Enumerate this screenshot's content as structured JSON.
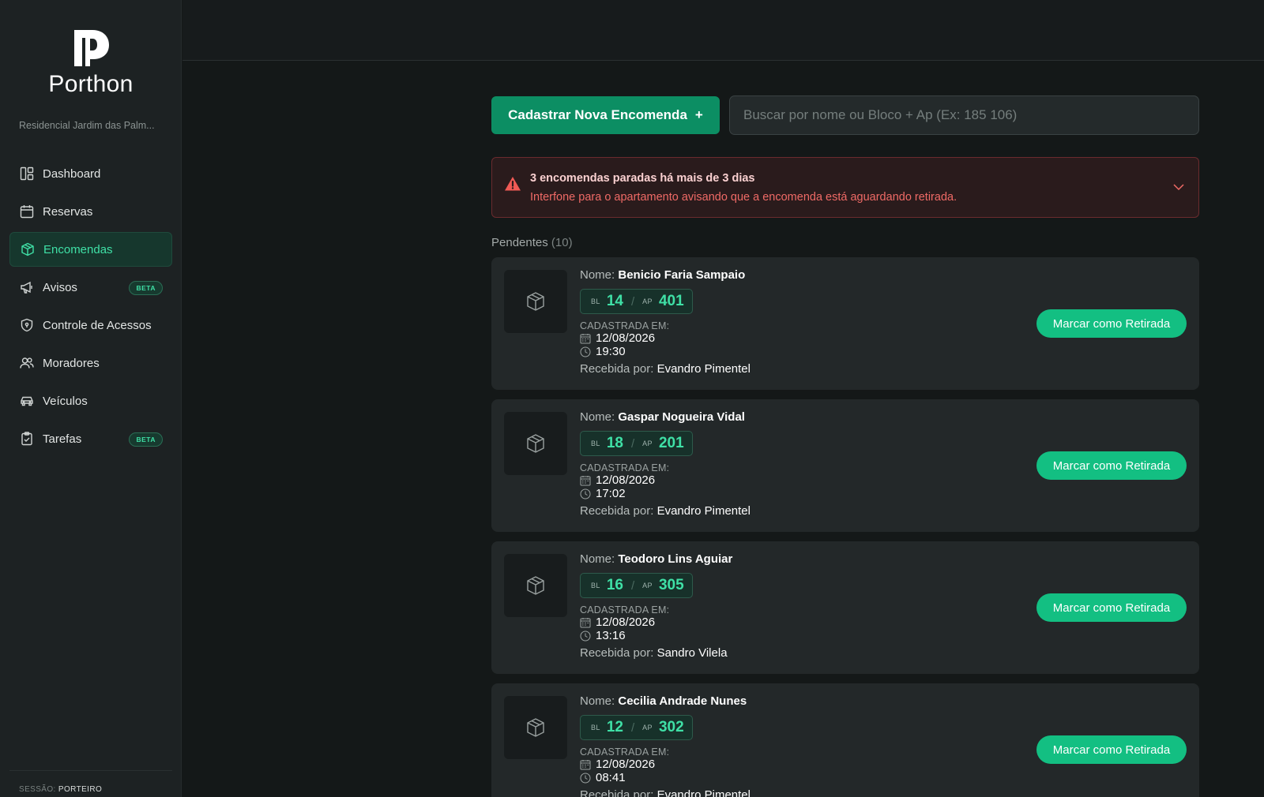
{
  "brand": {
    "name": "Porthon",
    "condo": "Residencial Jardim das Palm..."
  },
  "nav": {
    "items": [
      {
        "label": "Dashboard",
        "icon": "dashboard-icon"
      },
      {
        "label": "Reservas",
        "icon": "calendar-icon"
      },
      {
        "label": "Encomendas",
        "icon": "package-icon",
        "active": true
      },
      {
        "label": "Avisos",
        "icon": "megaphone-icon",
        "badge": "BETA"
      },
      {
        "label": "Controle de Acessos",
        "icon": "shield-icon"
      },
      {
        "label": "Moradores",
        "icon": "users-icon"
      },
      {
        "label": "Veículos",
        "icon": "car-icon"
      },
      {
        "label": "Tarefas",
        "icon": "clipboard-icon",
        "badge": "BETA"
      }
    ]
  },
  "session": {
    "label": "SESSÃO:",
    "role": "PORTEIRO"
  },
  "toolbar": {
    "new_label": "Cadastrar Nova Encomenda",
    "new_plus": "+",
    "search_placeholder": "Buscar por nome ou Bloco + Ap (Ex: 185 106)"
  },
  "alert": {
    "title": "3 encomendas paradas há mais de 3 dias",
    "text": "Interfone para o apartamento avisando que a encomenda está aguardando retirada."
  },
  "pending": {
    "label": "Pendentes",
    "count": "(10)"
  },
  "labels": {
    "name": "Nome:",
    "bl": "BL",
    "ap": "AP",
    "registered": "CADASTRADA EM:",
    "received_by": "Recebida por:",
    "action": "Marcar como Retirada"
  },
  "packages": [
    {
      "name": "Benicio Faria Sampaio",
      "bl": "14",
      "ap": "401",
      "date": "12/08/2026",
      "time": "19:30",
      "received_by": "Evandro Pimentel"
    },
    {
      "name": "Gaspar Nogueira Vidal",
      "bl": "18",
      "ap": "201",
      "date": "12/08/2026",
      "time": "17:02",
      "received_by": "Evandro Pimentel"
    },
    {
      "name": "Teodoro Lins Aguiar",
      "bl": "16",
      "ap": "305",
      "date": "12/08/2026",
      "time": "13:16",
      "received_by": "Sandro Vilela"
    },
    {
      "name": "Cecilia Andrade Nunes",
      "bl": "12",
      "ap": "302",
      "date": "12/08/2026",
      "time": "08:41",
      "received_by": "Evandro Pimentel"
    }
  ],
  "colors": {
    "accent": "#13bf82",
    "accent_dark": "#0c8e63",
    "alert": "#ef6a66"
  }
}
